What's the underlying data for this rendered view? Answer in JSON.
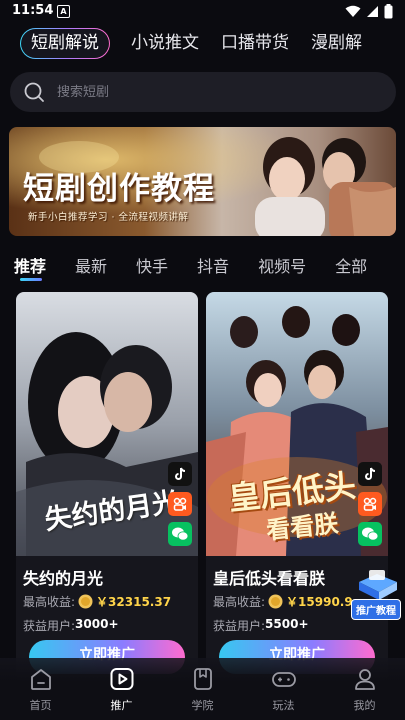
{
  "status": {
    "time": "11:54",
    "notif_letter": "A"
  },
  "top_tabs": [
    "短剧解说",
    "小说推文",
    "口播带货",
    "漫剧解"
  ],
  "search": {
    "placeholder": "搜索短剧"
  },
  "banner": {
    "title": "短剧创作教程",
    "subtitle": "新手小白推荐学习 · 全流程视频讲解"
  },
  "sub_tabs": [
    "推荐",
    "最新",
    "快手",
    "抖音",
    "视频号",
    "全部"
  ],
  "cards": [
    {
      "poster_text": "失约的月光",
      "title": "失约的月光",
      "earn_label": "最高收益:",
      "earn_value": "￥32315.37",
      "users_label": "获益用户:",
      "users_value": "3000+",
      "button": "立即推广"
    },
    {
      "poster_text_1": "皇后低头",
      "poster_text_2": "看看朕",
      "title": "皇后低头看看朕",
      "earn_label": "最高收益:",
      "earn_value": "￥15990.9",
      "users_label": "获益用户:",
      "users_value": "5500+",
      "button": "立即推广"
    }
  ],
  "tutorial_badge": "推广教程",
  "bottom_nav": [
    {
      "label": "首页",
      "icon": "home-icon"
    },
    {
      "label": "推广",
      "icon": "play-icon"
    },
    {
      "label": "学院",
      "icon": "book-icon"
    },
    {
      "label": "玩法",
      "icon": "gamepad-icon"
    },
    {
      "label": "我的",
      "icon": "user-icon"
    }
  ],
  "active_nav": "推广",
  "colors": {
    "accent_cyan": "#3cd6f5",
    "accent_pink": "#ff6bcf",
    "money": "#ffd44a"
  }
}
